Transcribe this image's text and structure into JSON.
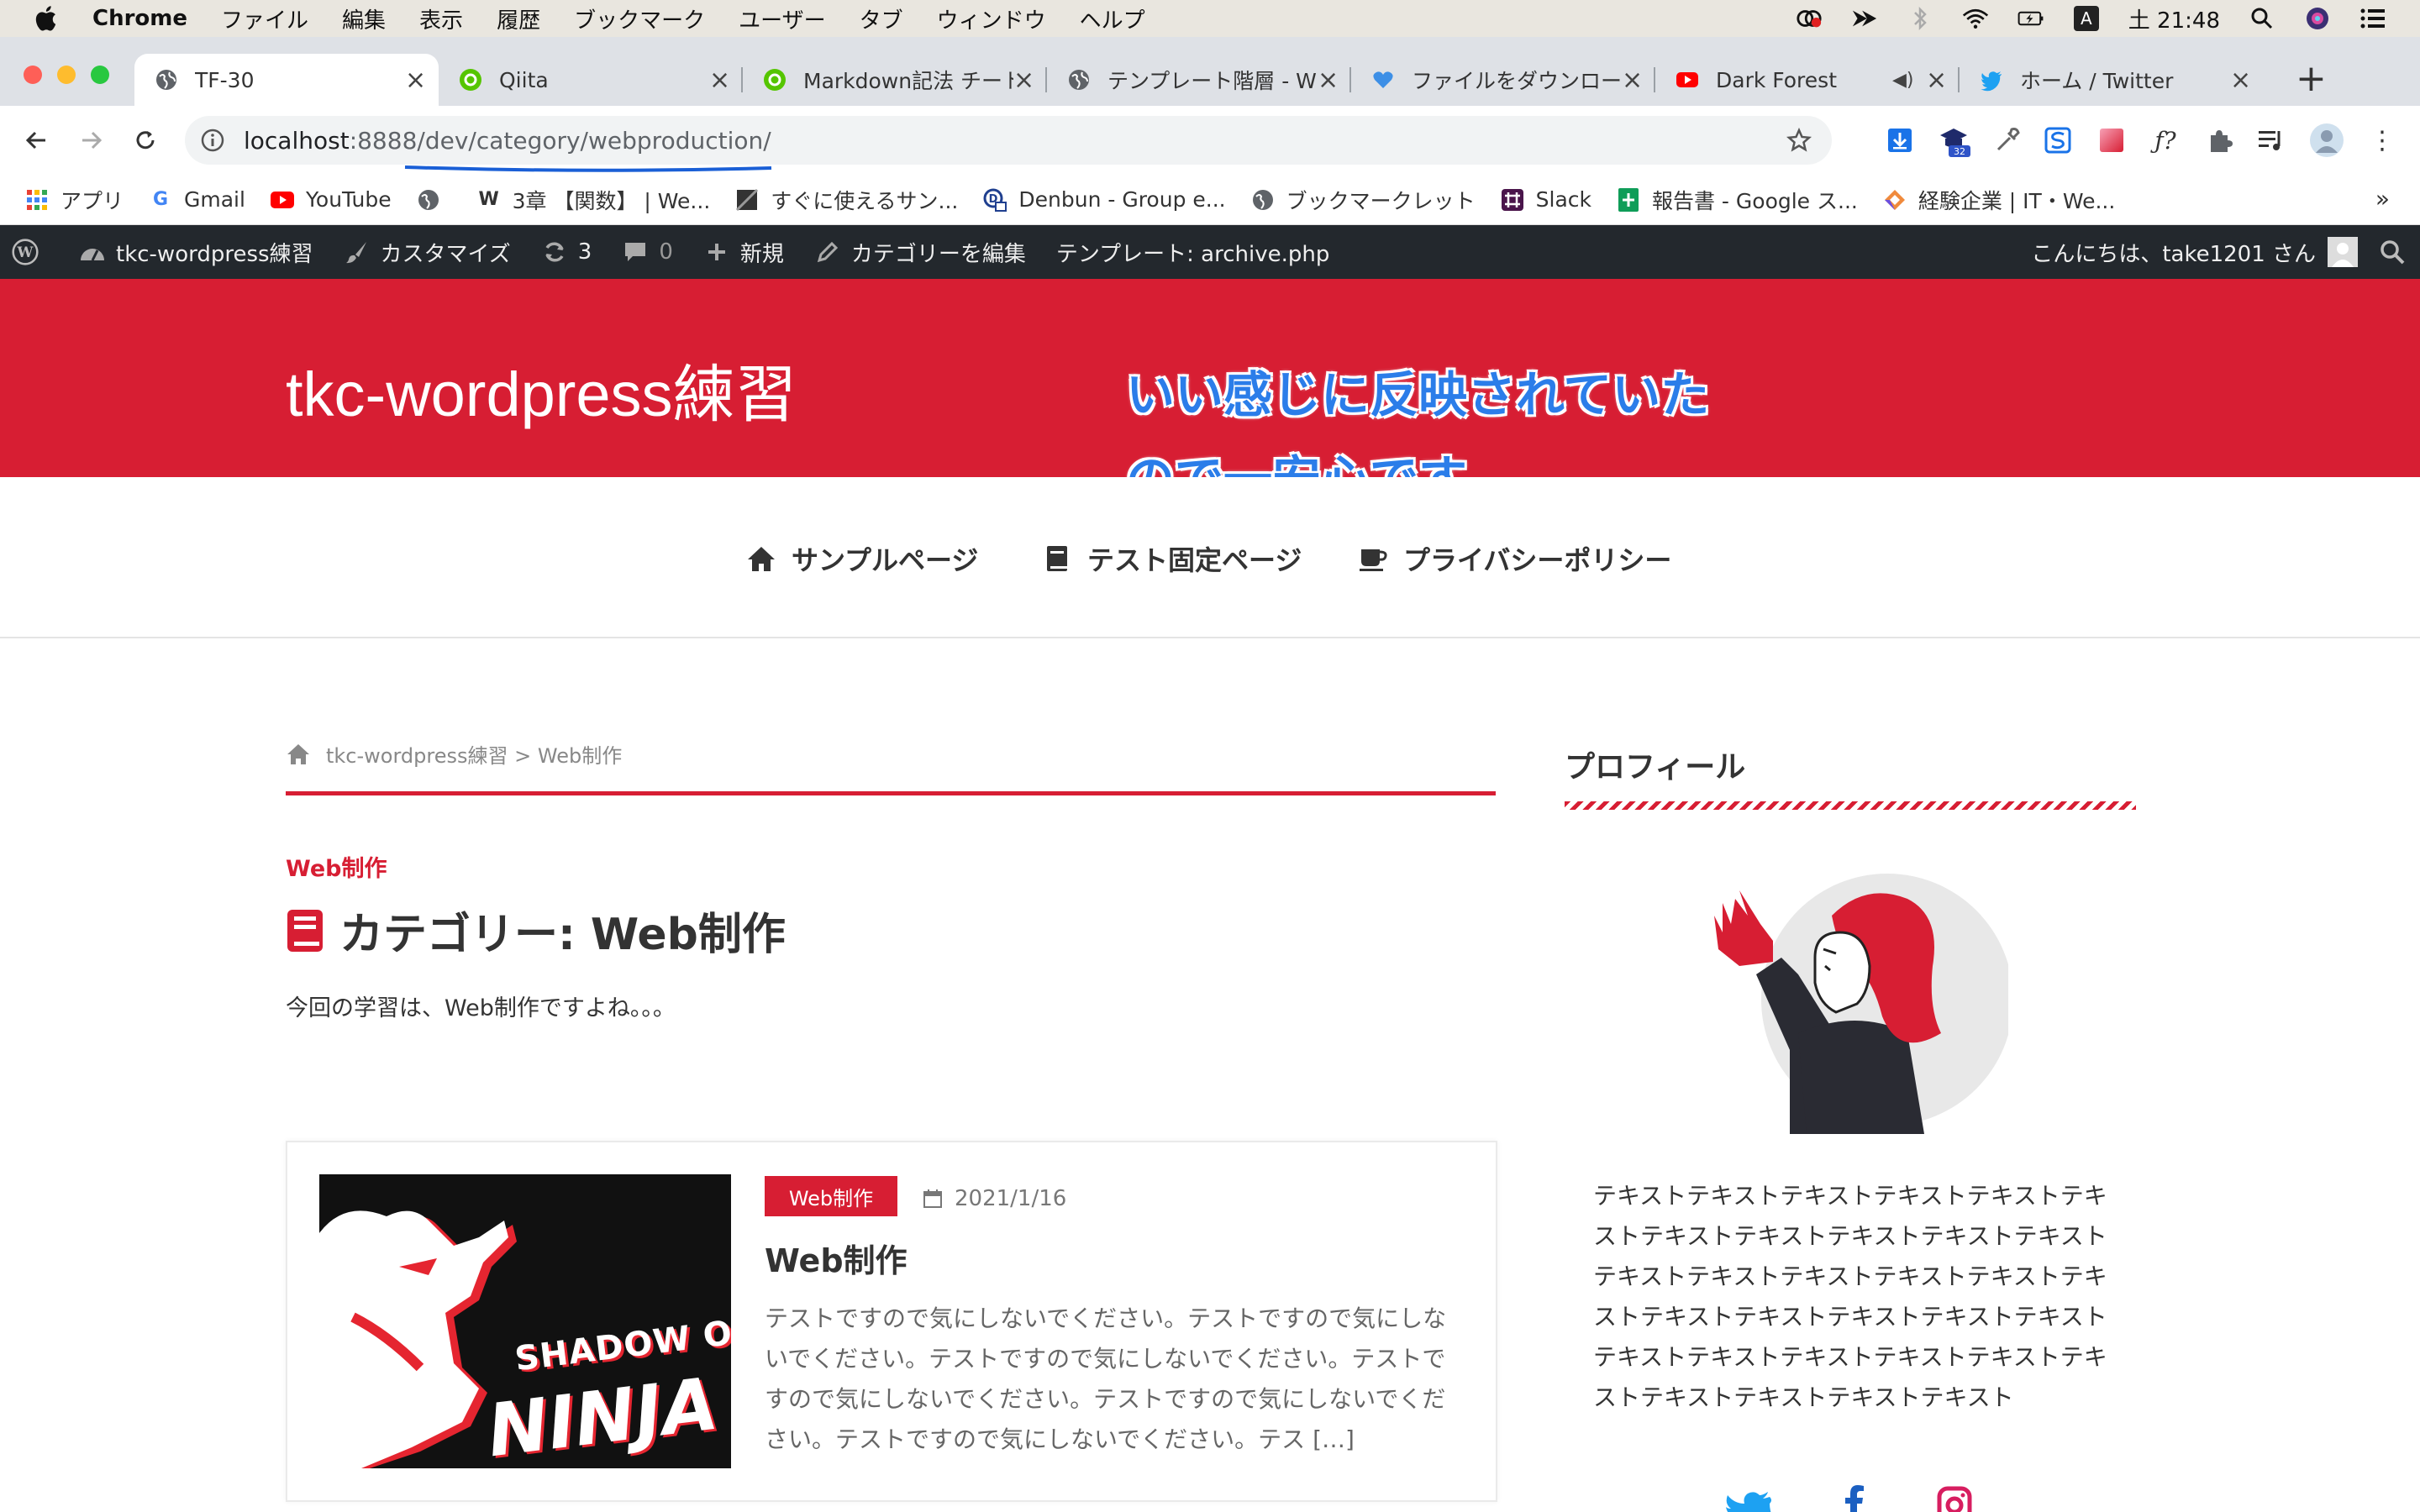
{
  "macos": {
    "menus": [
      "Chrome",
      "ファイル",
      "編集",
      "表示",
      "履歴",
      "ブックマーク",
      "ユーザー",
      "タブ",
      "ウィンドウ",
      "ヘルプ"
    ],
    "clock": "土 21:48",
    "input_indicator": "A"
  },
  "tabs": [
    {
      "title": "TF-30",
      "active": true,
      "icon": "globe-icon"
    },
    {
      "title": "Qiita",
      "active": false,
      "icon": "qiita-icon"
    },
    {
      "title": "Markdown記法 チートシ",
      "active": false,
      "icon": "qiita-icon"
    },
    {
      "title": "テンプレート階層 - W",
      "active": false,
      "icon": "globe-icon"
    },
    {
      "title": "ファイルをダウンロー",
      "active": false,
      "icon": "heart-icon"
    },
    {
      "title": "Dark Forest",
      "active": false,
      "icon": "youtube-icon"
    },
    {
      "title": "ホーム / Twitter",
      "active": false,
      "icon": "twitter-icon"
    }
  ],
  "toolbar": {
    "url_host": "localhost",
    "url_rest": ":8888/dev/category/webproduction/",
    "extension_badge": "32"
  },
  "bookmarks": [
    {
      "label": "アプリ",
      "icon": "apps-grid-icon"
    },
    {
      "label": "Gmail",
      "icon": "google-icon"
    },
    {
      "label": "YouTube",
      "icon": "youtube-icon"
    },
    {
      "label": "",
      "icon": "globe-icon"
    },
    {
      "label": "3章 【関数】 | We...",
      "icon": "w-icon"
    },
    {
      "label": "すぐに使えるサン...",
      "icon": "square-icon"
    },
    {
      "label": "Denbun - Group e...",
      "icon": "denbun-icon"
    },
    {
      "label": "ブックマークレット",
      "icon": "globe-icon"
    },
    {
      "label": "Slack",
      "icon": "slack-icon"
    },
    {
      "label": "報告書 - Google ス...",
      "icon": "sheets-icon"
    },
    {
      "label": "経験企業 | IT・We...",
      "icon": "diamond-icon"
    }
  ],
  "adminbar": {
    "site": "tkc-wordpress練習",
    "customize": "カスタマイズ",
    "updates": "3",
    "comments": "0",
    "new": "新規",
    "edit_category": "カテゴリーを編集",
    "template": "テンプレート: archive.php",
    "greeting": "こんにちは、take1201 さん"
  },
  "site": {
    "title": "tkc-wordpress練習",
    "annotation_line1": "いい感じに反映されていた",
    "annotation_line2": "ので一安心です。"
  },
  "nav": [
    {
      "label": "サンプルページ",
      "icon": "home-icon"
    },
    {
      "label": "テスト固定ページ",
      "icon": "book-icon"
    },
    {
      "label": "プライバシーポリシー",
      "icon": "coffee-icon"
    }
  ],
  "main": {
    "breadcrumb": "tkc-wordpress練習 > Web制作",
    "category_label": "Web制作",
    "page_title": "カテゴリー: Web制作",
    "description": "今回の学習は、Web制作ですよね。。。"
  },
  "post": {
    "thumb_line1": "SHADOW OF",
    "thumb_line2": "NINJA",
    "badge": "Web制作",
    "date": "2021/1/16",
    "title": "Web制作",
    "excerpt": "テストですので気にしないでください。テストですので気にしないでください。テストですので気にしないでください。テストですので気にしないでください。テストですので気にしないでください。テストですので気にしないでください。テス […]"
  },
  "sidebar": {
    "title": "プロフィール",
    "text": "テキストテキストテキストテキストテキストテキストテキストテキストテキストテキストテキストテキストテキストテキストテキストテキストテキストテキストテキストテキストテキストテキストテキストテキストテキストテキストテキストテキストテキストテキストテキストテキスト"
  },
  "colors": {
    "brand_red": "#d71e33",
    "annotation_blue": "#2b7de9",
    "adminbar": "#23282d"
  }
}
